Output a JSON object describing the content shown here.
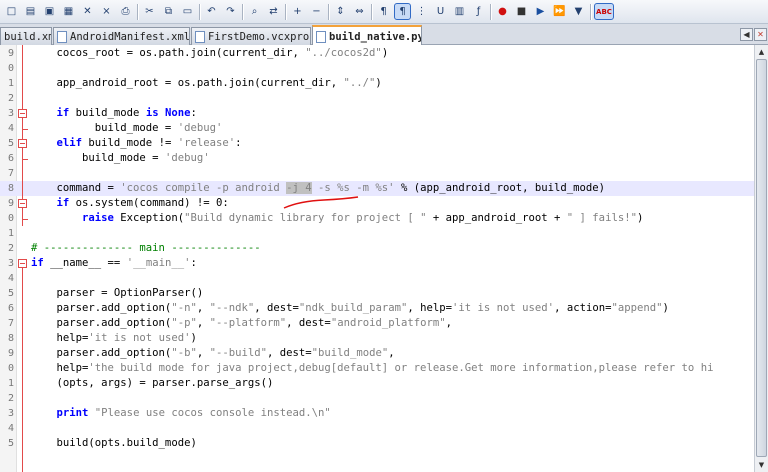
{
  "toolbar": {
    "icons": [
      "new-file-icon",
      "open-file-icon",
      "save-icon",
      "save-all-icon",
      "close-icon",
      "close-all-icon",
      "print-icon",
      "cut-icon",
      "copy-icon",
      "paste-icon",
      "undo-icon",
      "redo-icon",
      "find-icon",
      "replace-icon",
      "zoom-in-icon",
      "zoom-out-icon",
      "sync-vertical-icon",
      "sync-horizontal-icon",
      "word-wrap-icon",
      "show-all-chars-icon",
      "indent-guide-icon",
      "user-language-icon",
      "document-map-icon",
      "function-list-icon",
      "record-macro-icon",
      "stop-recording-icon",
      "play-macro-icon",
      "run-macro-multiple-icon",
      "save-macro-icon",
      "spell-check-icon",
      "monitoring-icon"
    ],
    "spell_check_label": "ABC"
  },
  "tabs": [
    {
      "label": "build.xml",
      "active": false
    },
    {
      "label": "AndroidManifest.xml",
      "active": false
    },
    {
      "label": "FirstDemo.vcxproj",
      "active": false
    },
    {
      "label": "build_native.py",
      "active": true
    }
  ],
  "editor": {
    "lines": [
      {
        "n": "9",
        "text": "    cocos_root = os.path.join(current_dir, \"../cocos2d\")"
      },
      {
        "n": "0",
        "text": ""
      },
      {
        "n": "1",
        "text": "    app_android_root = os.path.join(current_dir, \"../\")"
      },
      {
        "n": "2",
        "text": ""
      },
      {
        "n": "3",
        "text": "    if build_mode is None:"
      },
      {
        "n": "4",
        "text": "          build_mode = 'debug'"
      },
      {
        "n": "5",
        "text": "    elif build_mode != 'release':"
      },
      {
        "n": "6",
        "text": "        build_mode = 'debug'"
      },
      {
        "n": "7",
        "text": ""
      },
      {
        "n": "8",
        "text": "    command = 'cocos compile -p android -j 4 -s %s -m %s' % (app_android_root, build_mode)"
      },
      {
        "n": "9",
        "text": "    if os.system(command) != 0:"
      },
      {
        "n": "0",
        "text": "        raise Exception(\"Build dynamic library for project [ \" + app_android_root + \" ] fails!\")"
      },
      {
        "n": "1",
        "text": ""
      },
      {
        "n": "2",
        "text": "# -------------- main --------------"
      },
      {
        "n": "3",
        "text": "if __name__ == '__main__':"
      },
      {
        "n": "4",
        "text": ""
      },
      {
        "n": "5",
        "text": "    parser = OptionParser()"
      },
      {
        "n": "6",
        "text": "    parser.add_option(\"-n\", \"--ndk\", dest=\"ndk_build_param\", help='it is not used', action=\"append\")"
      },
      {
        "n": "7",
        "text": "    parser.add_option(\"-p\", \"--platform\", dest=\"android_platform\","
      },
      {
        "n": "8",
        "text": "    help='it is not used')"
      },
      {
        "n": "9",
        "text": "    parser.add_option(\"-b\", \"--build\", dest=\"build_mode\","
      },
      {
        "n": "0",
        "text": "    help='the build mode for java project,debug[default] or release.Get more information,please refer to hi"
      },
      {
        "n": "1",
        "text": "    (opts, args) = parser.parse_args()"
      },
      {
        "n": "2",
        "text": ""
      },
      {
        "n": "3",
        "text": "    print \"Please use cocos console instead.\\n\""
      },
      {
        "n": "4",
        "text": ""
      },
      {
        "n": "5",
        "text": "    build(opts.build_mode)"
      }
    ]
  }
}
